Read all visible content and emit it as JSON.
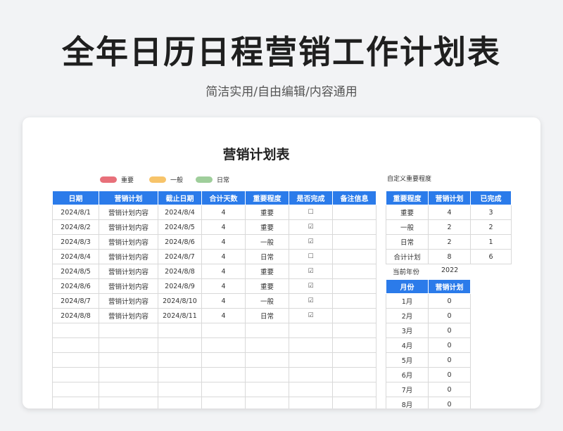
{
  "hero": {
    "title": "全年日历日程营销工作计划表",
    "subtitle": "简洁实用/自由编辑/内容通用"
  },
  "sheet": {
    "title": "营销计划表",
    "legend": [
      {
        "label": "重要",
        "color": "#e8707a"
      },
      {
        "label": "一般",
        "color": "#f7c46a"
      },
      {
        "label": "日常",
        "color": "#9fce9b"
      }
    ],
    "custom_label": "自定义重要程度"
  },
  "main_table": {
    "headers": [
      "日期",
      "营销计划",
      "截止日期",
      "合计天数",
      "重要程度",
      "是否完成",
      "备注信息"
    ],
    "rows": [
      [
        "2024/8/1",
        "营销计划内容",
        "2024/8/4",
        "4",
        "重要",
        "☐",
        ""
      ],
      [
        "2024/8/2",
        "营销计划内容",
        "2024/8/5",
        "4",
        "重要",
        "☑",
        ""
      ],
      [
        "2024/8/3",
        "营销计划内容",
        "2024/8/6",
        "4",
        "一般",
        "☑",
        ""
      ],
      [
        "2024/8/4",
        "营销计划内容",
        "2024/8/7",
        "4",
        "日常",
        "☐",
        ""
      ],
      [
        "2024/8/5",
        "营销计划内容",
        "2024/8/8",
        "4",
        "重要",
        "☑",
        ""
      ],
      [
        "2024/8/6",
        "营销计划内容",
        "2024/8/9",
        "4",
        "重要",
        "☑",
        ""
      ],
      [
        "2024/8/7",
        "营销计划内容",
        "2024/8/10",
        "4",
        "一般",
        "☑",
        ""
      ],
      [
        "2024/8/8",
        "营销计划内容",
        "2024/8/11",
        "4",
        "日常",
        "☑",
        ""
      ],
      [
        "",
        "",
        "",
        "",
        "",
        "",
        ""
      ],
      [
        "",
        "",
        "",
        "",
        "",
        "",
        ""
      ],
      [
        "",
        "",
        "",
        "",
        "",
        "",
        ""
      ],
      [
        "",
        "",
        "",
        "",
        "",
        "",
        ""
      ],
      [
        "",
        "",
        "",
        "",
        "",
        "",
        ""
      ],
      [
        "",
        "",
        "",
        "",
        "",
        "",
        ""
      ]
    ]
  },
  "priority_table": {
    "headers": [
      "重要程度",
      "营销计划",
      "已完成"
    ],
    "rows": [
      [
        "重要",
        "4",
        "3"
      ],
      [
        "一般",
        "2",
        "2"
      ],
      [
        "日常",
        "2",
        "1"
      ],
      [
        "合计计划",
        "8",
        "6"
      ]
    ]
  },
  "year": {
    "label": "当前年份",
    "value": "2022"
  },
  "month_table": {
    "headers": [
      "月份",
      "营销计划"
    ],
    "rows": [
      [
        "1月",
        "0"
      ],
      [
        "2月",
        "0"
      ],
      [
        "3月",
        "0"
      ],
      [
        "4月",
        "0"
      ],
      [
        "5月",
        "0"
      ],
      [
        "6月",
        "0"
      ],
      [
        "7月",
        "0"
      ],
      [
        "8月",
        "0"
      ]
    ]
  }
}
